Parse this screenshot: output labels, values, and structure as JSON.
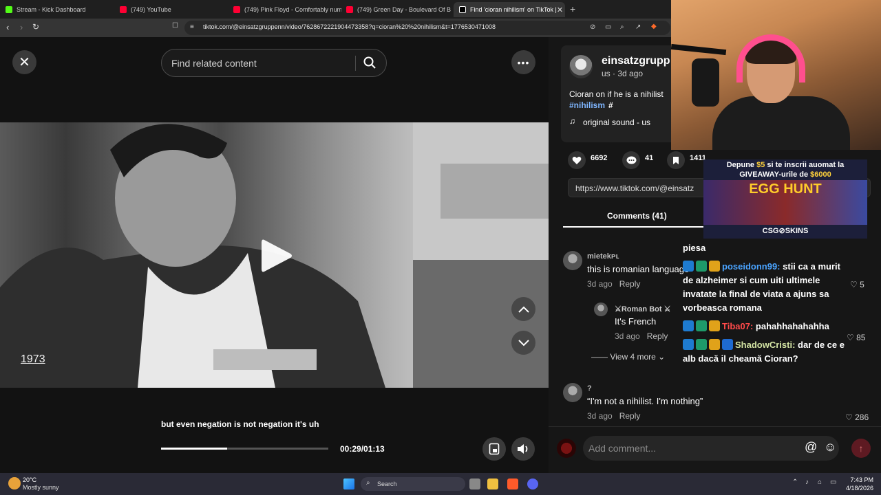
{
  "browser": {
    "tabs": [
      {
        "label": "Stream - Kick Dashboard",
        "favicon_color": "#53fc18"
      },
      {
        "label": "(749) YouTube",
        "favicon_color": "#ff0033"
      },
      {
        "label": "(749) Pink Floyd - Comfortably numb",
        "favicon_color": "#ff0033"
      },
      {
        "label": "(749) Green Day - Boulevard Of Broken",
        "favicon_color": "#ff0033"
      },
      {
        "label": "Find 'cioran nihilism' on TikTok |",
        "favicon_color": "#ffffff"
      }
    ],
    "new_tab": "+",
    "close_tab": "✕",
    "url": "tiktok.com/@einsatzgruppenn/video/7628672221904473358?q=cioran%20%20nihilism&t=1776530471008"
  },
  "video": {
    "search_placeholder": "Find related content",
    "year_label": "1973",
    "caption": "but even negation is not negation it's uh",
    "time": "00:29/01:13",
    "progress": 0.397
  },
  "post": {
    "author": "einsatzgrupp",
    "meta": "us · 3d ago",
    "description": "Cioran on if he is a nihilist",
    "hashtag": "#nihilism",
    "hashtag_extra": "#",
    "sound": "original sound - us",
    "likes": "6692",
    "comments_count": "41",
    "saves": "1411",
    "share_link": "https://www.tiktok.com/@einsatz",
    "comments_tab": "Comments (41)"
  },
  "comments": [
    {
      "name": "mietekᴘʟ",
      "text": "this is romanian language",
      "time": "3d ago",
      "reply": "Reply",
      "likes": "5"
    },
    {
      "name": "⚔Roman Bot ⚔",
      "text": "It's French",
      "time": "3d ago",
      "reply": "Reply",
      "likes": "85"
    },
    {
      "view_more": "View 4 more"
    },
    {
      "name": "?",
      "text": "“I'm not a nihilist. I'm nothing”",
      "time": "3d ago",
      "reply": "Reply",
      "likes": "286"
    }
  ],
  "comment_box": {
    "placeholder": "Add comment..."
  },
  "stream_overlay": {
    "promo_line1_a": "Depune ",
    "promo_line1_amount": "$5",
    "promo_line1_b": " si te inscrii auomat la",
    "promo_line2_a": "GIVEAWAY-urile de ",
    "promo_line2_amount": "$6000",
    "promo_title": "EGG HUNT",
    "promo_brand": "CSG⊘SKINS"
  },
  "chat": [
    {
      "user": "",
      "text": "piesa"
    },
    {
      "user": "poseidonn99:",
      "text": "stii ca a murit",
      "user_color": "#4aa3ff"
    },
    {
      "user": "",
      "text": "de alzheimer si cum uiti ultimele"
    },
    {
      "user": "",
      "text": "invatate la final de viata a ajuns sa"
    },
    {
      "user": "",
      "text": "vorbeasca romana"
    },
    {
      "user": "Tiba07:",
      "text": "pahahhahahahha",
      "user_color": "#ff4a4a"
    },
    {
      "user": "ShadowCristi:",
      "text": "dar de ce e",
      "user_color": "#d4e4a4"
    },
    {
      "user": "",
      "text": "alb dacă il cheamă Cioran?"
    }
  ],
  "taskbar": {
    "temp": "20°C",
    "weather": "Mostly sunny",
    "search": "Search",
    "time": "7:43 PM",
    "date": "4/18/2026"
  }
}
